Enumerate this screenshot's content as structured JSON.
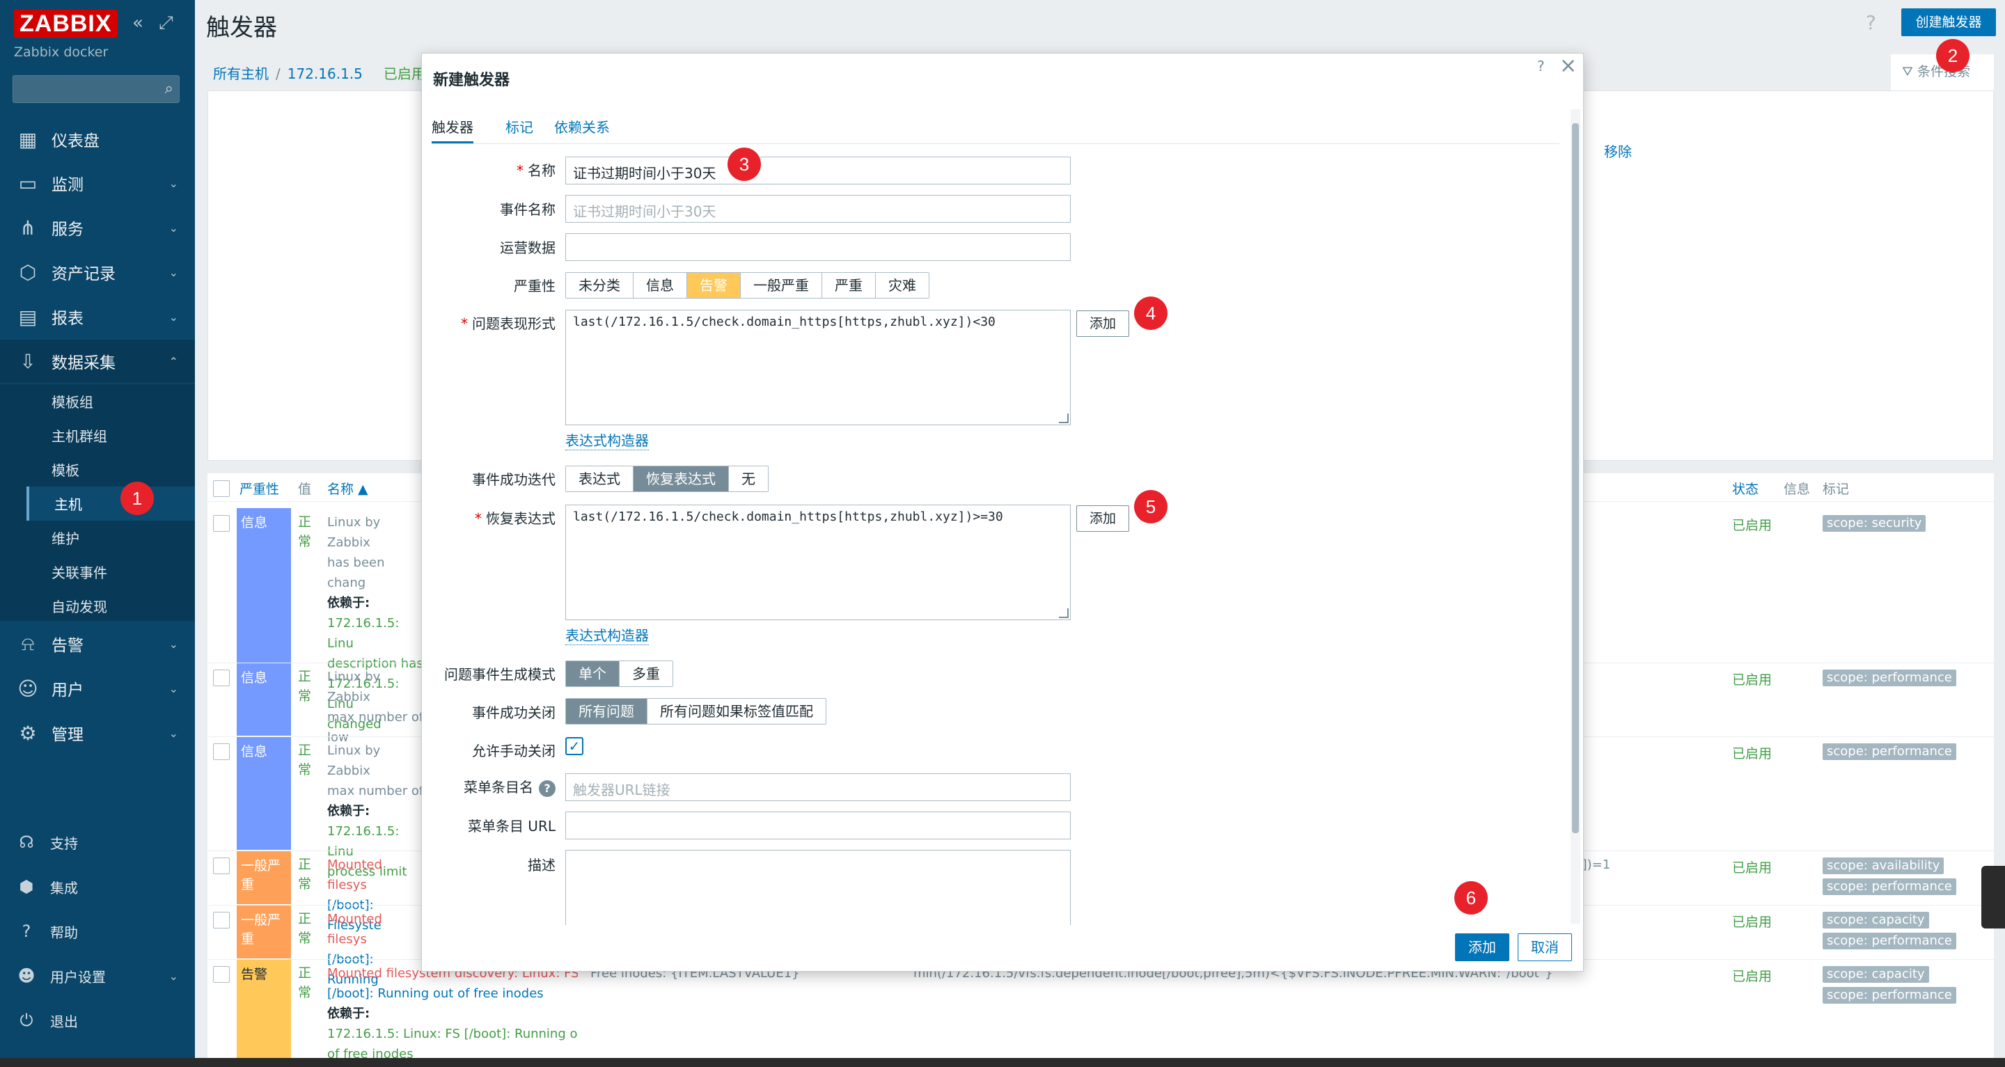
{
  "sidebar": {
    "logo": "ZABBIX",
    "server_name": "Zabbix docker",
    "menu": [
      {
        "label": "仪表盘",
        "icon": "dashboard-icon"
      },
      {
        "label": "监测",
        "icon": "monitoring-icon"
      },
      {
        "label": "服务",
        "icon": "services-icon"
      },
      {
        "label": "资产记录",
        "icon": "inventory-icon"
      },
      {
        "label": "报表",
        "icon": "reports-icon"
      },
      {
        "label": "数据采集",
        "icon": "data-collection-icon"
      },
      {
        "label": "告警",
        "icon": "alerts-icon"
      },
      {
        "label": "用户",
        "icon": "users-icon"
      },
      {
        "label": "管理",
        "icon": "administration-icon"
      }
    ],
    "submenu": [
      "模板组",
      "主机群组",
      "模板",
      "主机",
      "维护",
      "关联事件",
      "自动发现"
    ],
    "bottom": [
      {
        "label": "支持",
        "icon": "support-icon"
      },
      {
        "label": "集成",
        "icon": "integrations-icon"
      },
      {
        "label": "帮助",
        "icon": "help-icon"
      },
      {
        "label": "用户设置",
        "icon": "user-settings-icon"
      },
      {
        "label": "退出",
        "icon": "signout-icon"
      }
    ]
  },
  "header": {
    "title": "触发器",
    "create_button": "创建触发器",
    "breadcrumb": [
      "所有主机",
      "172.16.1.5",
      "已启用"
    ],
    "filter_label": "条件搜索",
    "remove_link": "移除"
  },
  "table": {
    "columns": {
      "severity": "严重性",
      "value": "值",
      "name": "名称 ▲",
      "status": "状态",
      "info": "信息",
      "tags": "标记"
    },
    "rows": [
      {
        "severity": "信息",
        "value": "正常",
        "name_lines": [
          "Linux by Zabbix",
          "has been chang",
          "依赖于:",
          "172.16.1.5: Linu",
          "description has",
          "172.16.1.5: Linu",
          "changed"
        ],
        "status": "已启用",
        "tags": [
          "scope: security"
        ]
      },
      {
        "severity": "信息",
        "value": "正常",
        "name_lines": [
          "Linux by Zabbix",
          "max number of",
          "low"
        ],
        "status": "已启用",
        "tags": [
          "scope: performance"
        ]
      },
      {
        "severity": "信息",
        "value": "正常",
        "name_lines": [
          "Linux by Zabbix",
          "max number of",
          "依赖于:",
          "172.16.1.5: Linu",
          "process limit"
        ],
        "status": "已启用",
        "tags": [
          "scope: performance"
        ]
      },
      {
        "severity": "一般严重",
        "value": "正常",
        "name_lines": [
          "Mounted filesys",
          "[/boot]: Filesyste"
        ],
        "status": "已启用",
        "tags": [
          "scope: availability",
          "scope: performance"
        ],
        "extra": "y])=1"
      },
      {
        "severity": "一般严重",
        "value": "正常",
        "name_lines": [
          "Mounted filesys",
          "[/boot]: Running"
        ],
        "status": "已启用",
        "tags": [
          "scope: capacity",
          "scope: performance"
        ]
      },
      {
        "severity": "告警",
        "value": "正常",
        "name_lines": [
          "Mounted filesystem discovery: Linux: FS",
          "[/boot]: Running out of free inodes",
          "依赖于:",
          "172.16.1.5: Linux: FS [/boot]: Running out",
          "of free inodes"
        ],
        "status": "已启用",
        "tags": [
          "scope: capacity",
          "scope: performance"
        ],
        "op_data": "Free inodes: {ITEM.LASTVALUE1}",
        "expression": "min(/172.16.1.5/vfs.fs.dependent.inode[/boot,pfree],5m)<{$VFS.FS.INODE.PFREE.MIN.WARN:\"/boot\"}"
      }
    ]
  },
  "modal": {
    "title": "新建触发器",
    "tabs": [
      "触发器",
      "标记",
      "依赖关系"
    ],
    "fields": {
      "name": {
        "label": "名称",
        "value": "证书过期时间小于30天"
      },
      "event_name": {
        "label": "事件名称",
        "placeholder": "证书过期时间小于30天"
      },
      "opdata": {
        "label": "运营数据",
        "value": ""
      },
      "severity": {
        "label": "严重性",
        "options": [
          "未分类",
          "信息",
          "告警",
          "一般严重",
          "严重",
          "灾难"
        ],
        "selected": "告警"
      },
      "expression": {
        "label": "问题表现形式",
        "value": "last(/172.16.1.5/check.domain_https[https,zhubl.xyz])<30"
      },
      "expression_builder": "表达式构造器",
      "recovery_mode": {
        "label": "事件成功迭代",
        "options": [
          "表达式",
          "恢复表达式",
          "无"
        ],
        "selected": "恢复表达式"
      },
      "recovery_expression": {
        "label": "恢复表达式",
        "value": "last(/172.16.1.5/check.domain_https[https,zhubl.xyz])>=30"
      },
      "recovery_builder": "表达式构造器",
      "problem_mode": {
        "label": "问题事件生成模式",
        "options": [
          "单个",
          "多重"
        ],
        "selected": "单个"
      },
      "ok_close": {
        "label": "事件成功关闭",
        "options": [
          "所有问题",
          "所有问题如果标签值匹配"
        ],
        "selected": "所有问题"
      },
      "manual_close": {
        "label": "允许手动关闭",
        "checked": true
      },
      "url_name": {
        "label": "菜单条目名",
        "placeholder": "触发器URL链接"
      },
      "url": {
        "label": "菜单条目 URL",
        "value": ""
      },
      "description": {
        "label": "描述",
        "value": ""
      }
    },
    "add_button": "添加",
    "footer_add": "添加",
    "footer_cancel": "取消"
  },
  "badges": [
    "1",
    "2",
    "3",
    "4",
    "5",
    "6"
  ],
  "colors": {
    "sidebar": "#0a466a",
    "accent": "#0275b8",
    "info": "#7499ff",
    "average": "#ffa059",
    "warning": "#ffc859",
    "ok": "#429e47",
    "badge": "#e8222b"
  }
}
